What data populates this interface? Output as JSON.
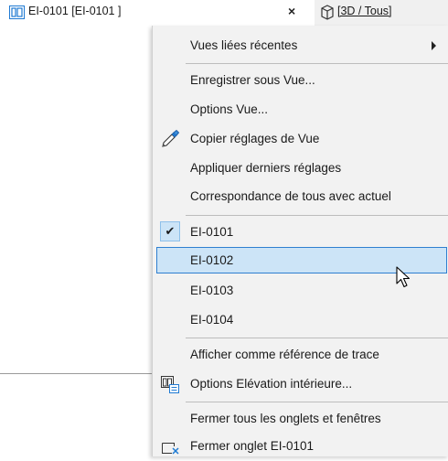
{
  "tabs": [
    {
      "label": "EI-0101 [EI-0101 ]",
      "icon": "interior-elevation-icon",
      "close": "×"
    },
    {
      "label": "[3D / Tous]",
      "icon": "3d-view-icon"
    }
  ],
  "menu": {
    "items": [
      {
        "label": "Vues liées récentes",
        "submenu": true
      },
      {
        "label": "Enregistrer sous Vue..."
      },
      {
        "label": "Options Vue..."
      },
      {
        "label": "Copier réglages de Vue",
        "icon": "eyedropper-icon"
      },
      {
        "label": "Appliquer derniers réglages"
      },
      {
        "label": "Correspondance de tous avec actuel"
      },
      {
        "label": "EI-0101",
        "checked": true
      },
      {
        "label": "EI-0102",
        "highlighted": true
      },
      {
        "label": "EI-0103"
      },
      {
        "label": "EI-0104"
      },
      {
        "label": "Afficher comme référence de trace"
      },
      {
        "label": "Options Elévation intérieure...",
        "icon": "elevation-options-icon"
      },
      {
        "label": "Fermer tous les onglets et fenêtres"
      },
      {
        "label": "Fermer onglet EI-0101",
        "icon": "close-tab-icon"
      }
    ]
  },
  "colors": {
    "highlight": "#cce4f7",
    "highlight_border": "#2f7fd0",
    "menu_bg": "#f2f2f2",
    "icon_blue": "#1f7ad3"
  }
}
